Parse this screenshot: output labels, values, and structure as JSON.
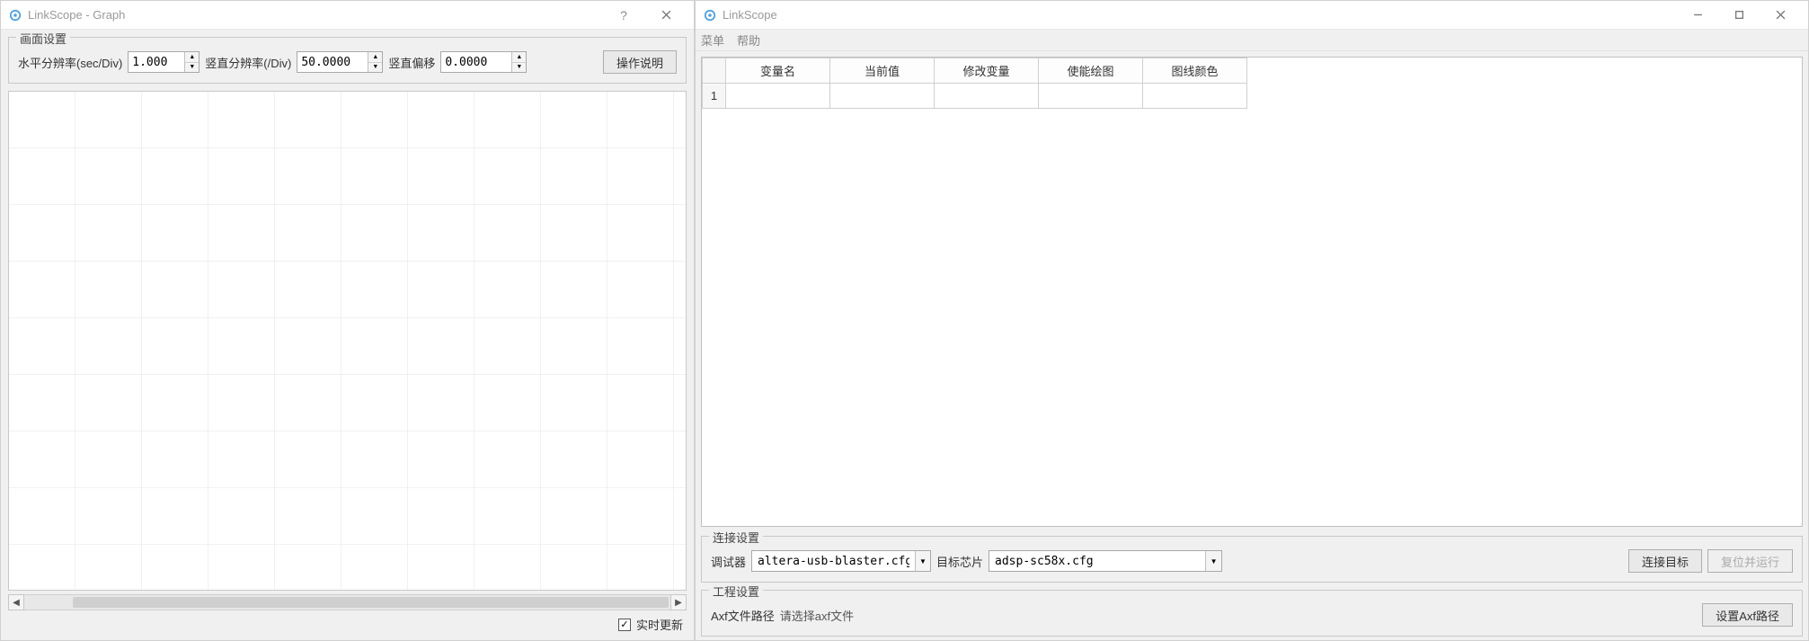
{
  "left": {
    "title": "LinkScope - Graph",
    "help_symbol": "?",
    "group_label": "画面设置",
    "hres_label": "水平分辨率(sec/Div)",
    "hres_value": "1.000",
    "vres_label": "竖直分辨率(/Div)",
    "vres_value": "50.0000",
    "voff_label": "竖直偏移",
    "voff_value": "0.0000",
    "instructions_btn": "操作说明",
    "realtime_label": "实时更新"
  },
  "right": {
    "title": "LinkScope",
    "menu": {
      "menu": "菜单",
      "help": "帮助"
    },
    "table": {
      "headers": [
        "变量名",
        "当前值",
        "修改变量",
        "使能绘图",
        "图线颜色"
      ],
      "row_number": "1"
    },
    "conn": {
      "legend": "连接设置",
      "debugger_label": "调试器",
      "debugger_value": "altera-usb-blaster.cfg",
      "chip_label": "目标芯片",
      "chip_value": "adsp-sc58x.cfg",
      "connect_btn": "连接目标",
      "resetrun_btn": "复位并运行"
    },
    "proj": {
      "legend": "工程设置",
      "axf_label": "Axf文件路径",
      "axf_placeholder": "请选择axf文件",
      "set_axf_btn": "设置Axf路径"
    }
  }
}
